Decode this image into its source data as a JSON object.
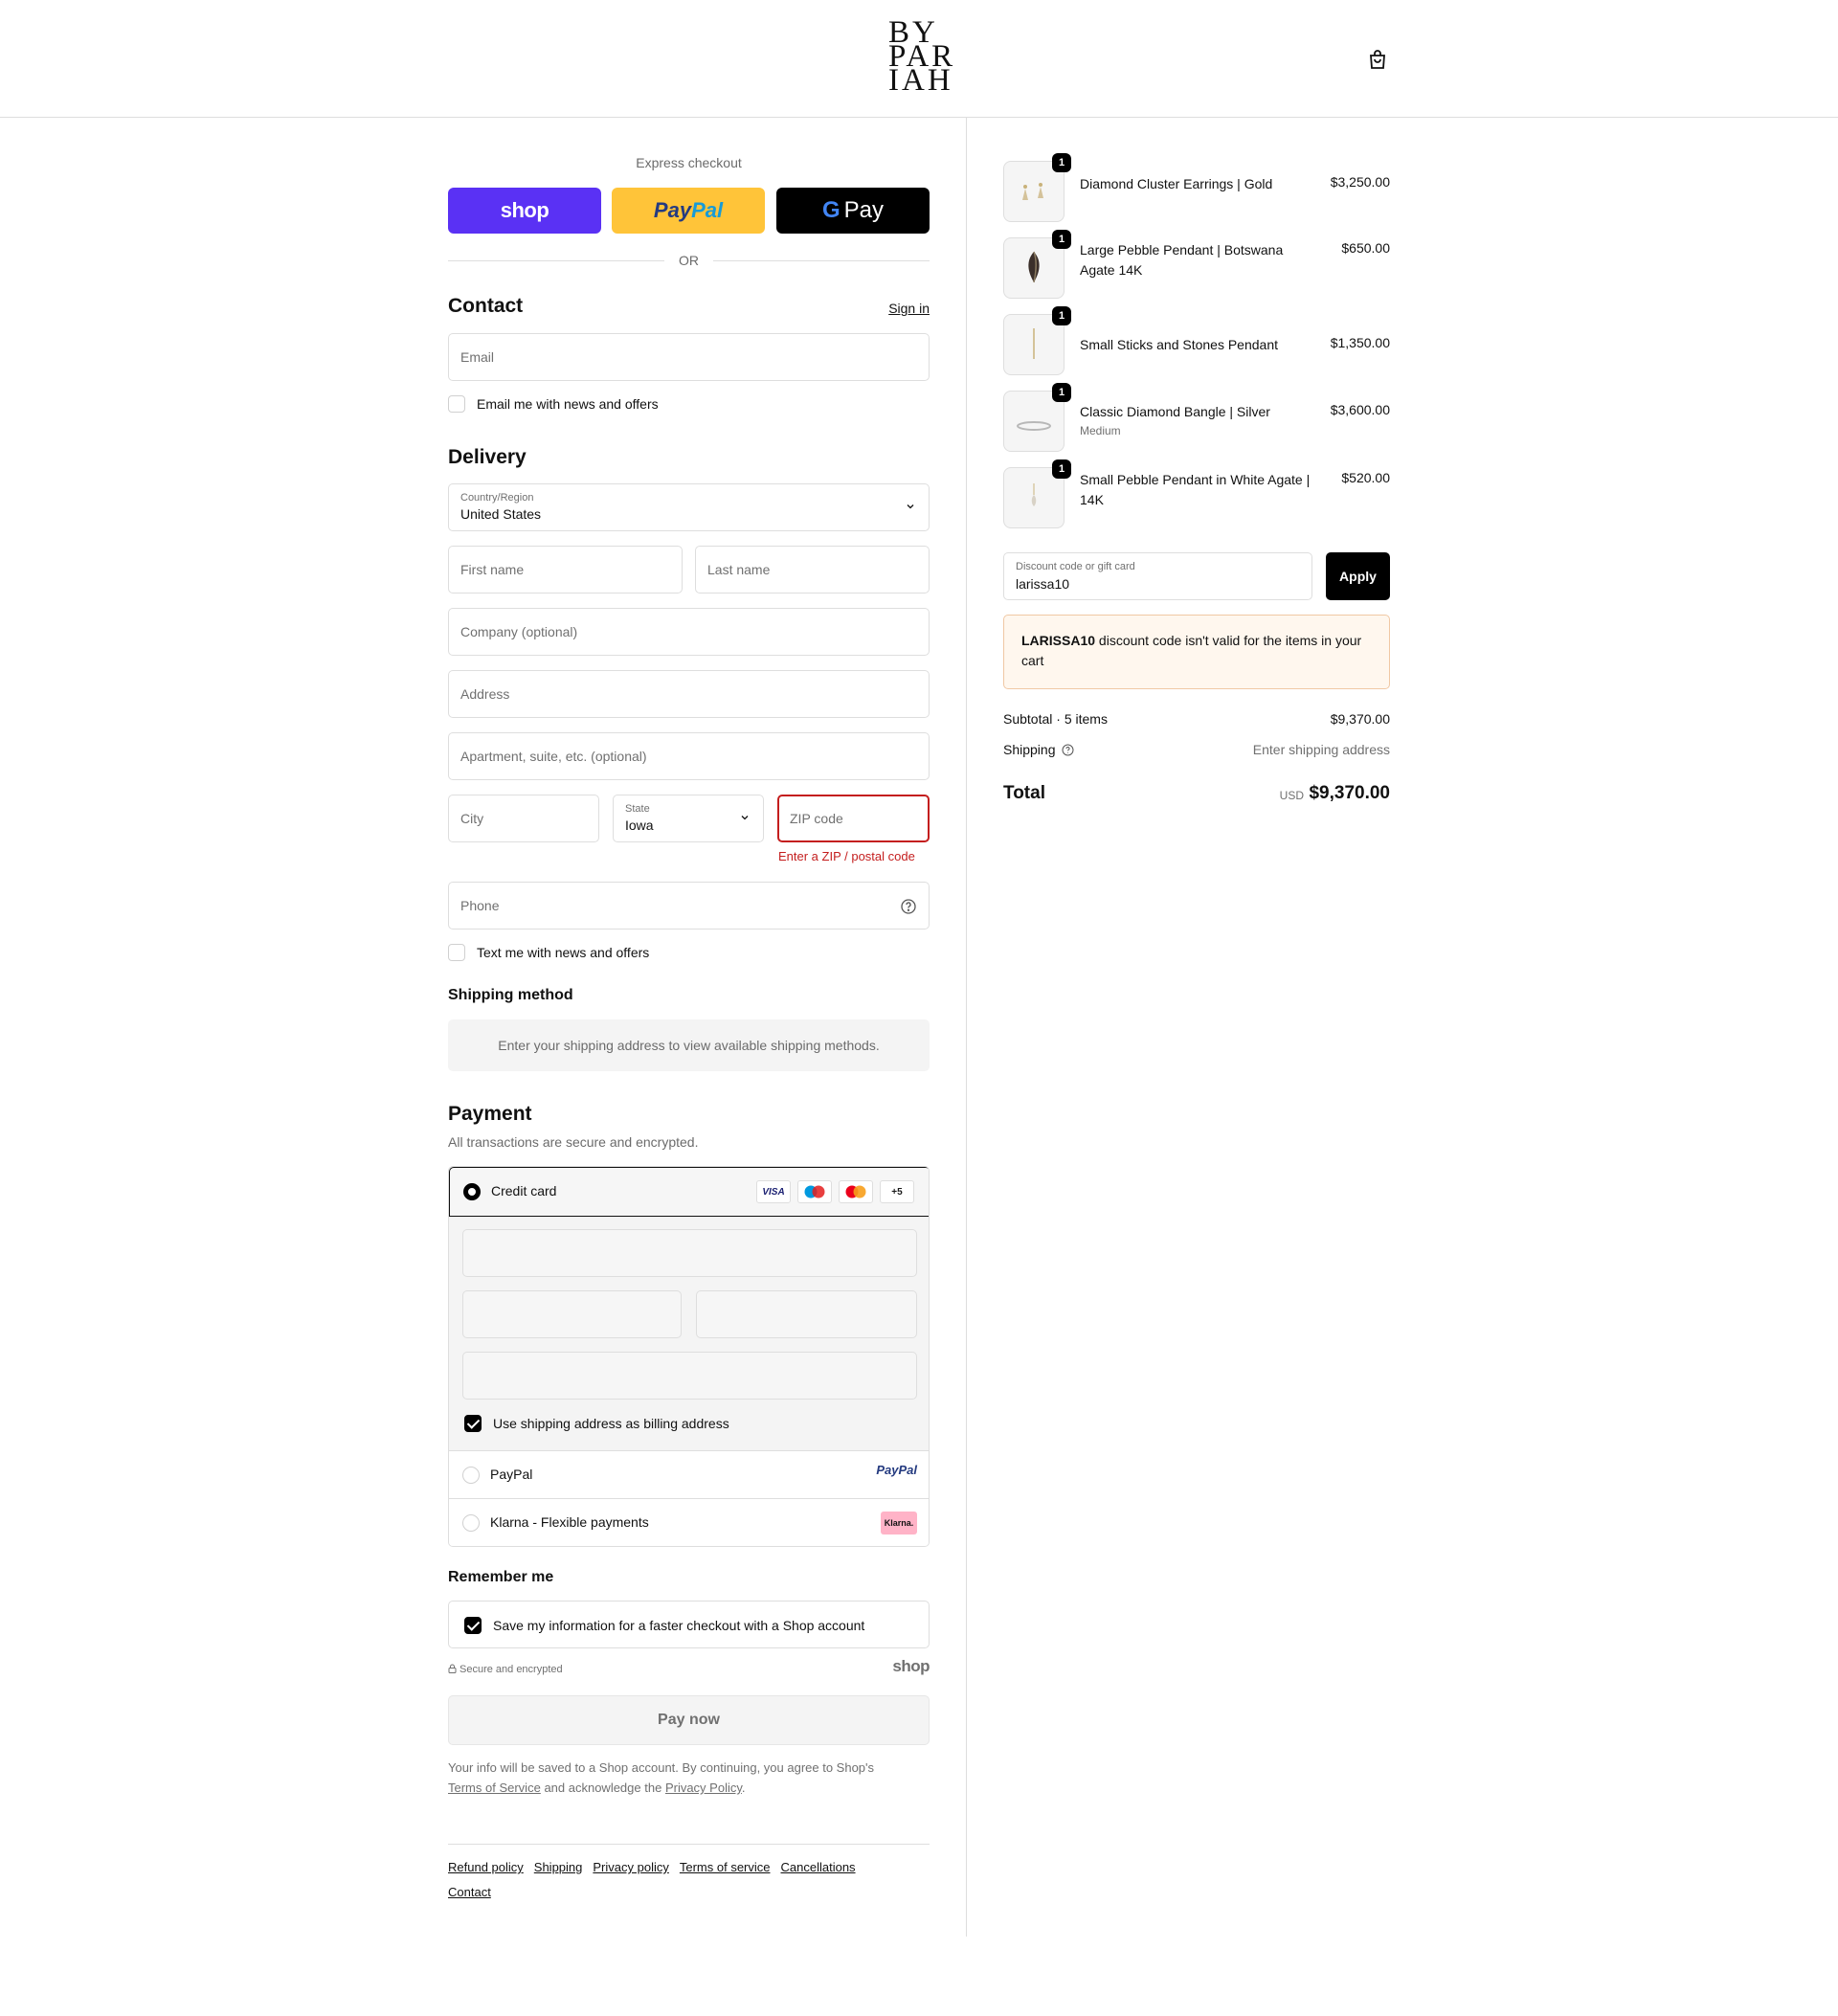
{
  "brand": {
    "logo_lines": [
      "BY",
      "PAR",
      "IAH"
    ]
  },
  "express": {
    "label": "Express checkout",
    "shop_label": "shop",
    "paypal_label_1": "Pay",
    "paypal_label_2": "Pal",
    "gpay_label": "Pay",
    "or": "OR"
  },
  "contact": {
    "title": "Contact",
    "sign_in": "Sign in",
    "email_placeholder": "Email",
    "news_checkbox": "Email me with news and offers"
  },
  "delivery": {
    "title": "Delivery",
    "country_label": "Country/Region",
    "country_value": "United States",
    "first_name": "First name",
    "last_name": "Last name",
    "company": "Company (optional)",
    "address": "Address",
    "apartment": "Apartment, suite, etc. (optional)",
    "city": "City",
    "state_label": "State",
    "state_value": "Iowa",
    "zip": "ZIP code",
    "zip_error": "Enter a ZIP / postal code",
    "phone": "Phone",
    "text_checkbox": "Text me with news and offers"
  },
  "shipping_method": {
    "title": "Shipping method",
    "message": "Enter your shipping address to view available shipping methods."
  },
  "payment": {
    "title": "Payment",
    "subtitle": "All transactions are secure and encrypted.",
    "credit_card": "Credit card",
    "cards": [
      "VISA",
      "Maestro",
      "Mastercard",
      "+5"
    ],
    "billing_checkbox": "Use shipping address as billing address",
    "paypal": "PayPal",
    "paypal_logo": "PayPal",
    "klarna": "Klarna - Flexible payments",
    "klarna_logo": "Klarna."
  },
  "remember": {
    "title": "Remember me",
    "save_checkbox": "Save my information for a faster checkout with a Shop account",
    "secure": "Secure and encrypted",
    "shop_logo": "shop"
  },
  "pay_now": "Pay now",
  "legal": {
    "text_1": "Your info will be saved to a Shop account. By continuing, you agree to Shop's",
    "tos": "Terms of Service",
    "text_2": "and acknowledge the",
    "privacy": "Privacy Policy",
    "text_3": "."
  },
  "footer_links": [
    "Refund policy",
    "Shipping",
    "Privacy policy",
    "Terms of service",
    "Cancellations",
    "Contact"
  ],
  "cart": {
    "items": [
      {
        "qty": "1",
        "name": "Diamond Cluster Earrings | Gold",
        "variant": "",
        "price": "$3,250.00"
      },
      {
        "qty": "1",
        "name": "Large Pebble Pendant | Botswana Agate 14K",
        "variant": "",
        "price": "$650.00"
      },
      {
        "qty": "1",
        "name": "Small Sticks and Stones Pendant",
        "variant": "",
        "price": "$1,350.00"
      },
      {
        "qty": "1",
        "name": "Classic Diamond Bangle | Silver",
        "variant": "Medium",
        "price": "$3,600.00"
      },
      {
        "qty": "1",
        "name": "Small Pebble Pendant in White Agate | 14K",
        "variant": "",
        "price": "$520.00"
      }
    ],
    "discount_label": "Discount code or gift card",
    "discount_value": "larissa10",
    "apply": "Apply",
    "warning_code": "LARISSA10",
    "warning_text": "discount code isn't valid for the items in your cart",
    "subtotal_label": "Subtotal · 5 items",
    "subtotal_value": "$9,370.00",
    "shipping_label": "Shipping",
    "shipping_value": "Enter shipping address",
    "total_label": "Total",
    "currency": "USD",
    "total_value": "$9,370.00"
  }
}
